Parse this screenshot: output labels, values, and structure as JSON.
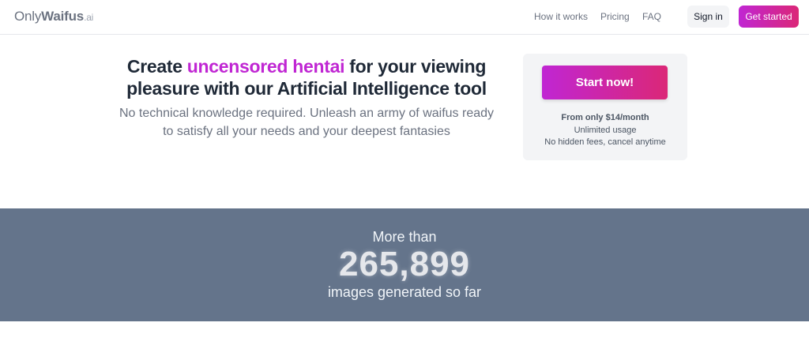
{
  "header": {
    "logo_part1": "Only",
    "logo_part2": "Waifus",
    "logo_part3": ".ai",
    "nav": [
      "How it works",
      "Pricing",
      "FAQ"
    ],
    "sign_in": "Sign in",
    "get_started": "Get started"
  },
  "hero": {
    "title_before": "Create ",
    "title_accent": "uncensored hentai",
    "title_after": " for your viewing pleasure with our Artificial Intelligence tool",
    "subtitle": "No technical knowledge required. Unleash an army of waifus ready to satisfy all your needs and your deepest fantasies"
  },
  "cta": {
    "button": "Start now!",
    "price": "From only $14/month",
    "usage": "Unlimited usage",
    "fees": "No hidden fees, cancel anytime"
  },
  "stats": {
    "prefix": "More than",
    "count": "265,899",
    "suffix": "images generated so far"
  },
  "colors": {
    "accent_start": "#c026d3",
    "accent_end": "#db2777",
    "stats_bg": "#64748b"
  }
}
